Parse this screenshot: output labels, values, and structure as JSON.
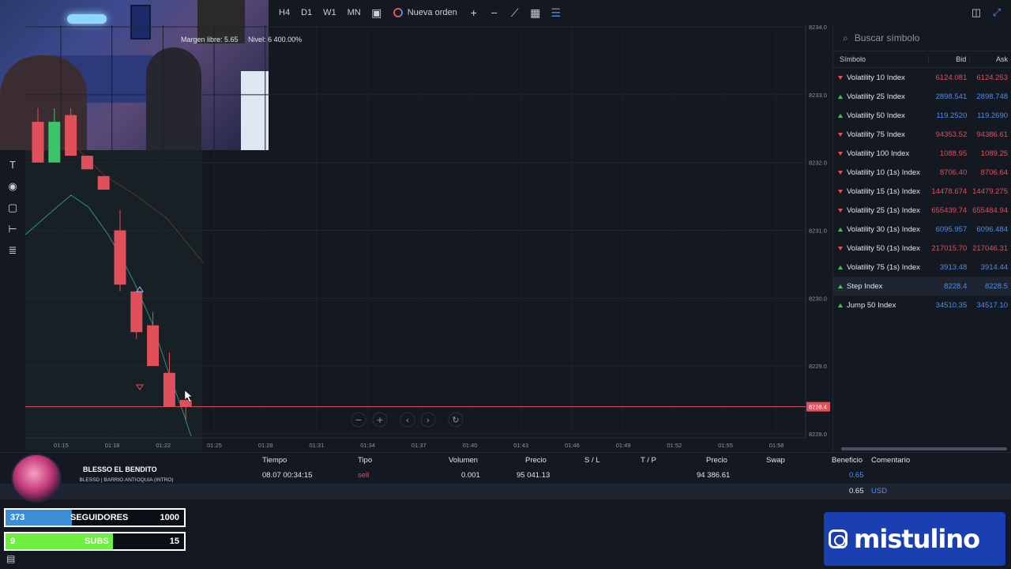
{
  "toolbar": {
    "timeframes": [
      "H4",
      "D1",
      "W1",
      "MN"
    ],
    "new_order": "Nueva orden"
  },
  "chart": {
    "price_ticks": [
      "8234.0",
      "8233.0",
      "8232.0",
      "8231.0",
      "8230.0",
      "8229.0",
      "8228.0"
    ],
    "current_price": "8228.4",
    "time_ticks": [
      "01:15",
      "01:18",
      "01:22",
      "01:25",
      "01:28",
      "01:31",
      "01:34",
      "01:37",
      "01:40",
      "01:43",
      "01:46",
      "01:49",
      "01:52",
      "01:55",
      "01:58"
    ],
    "candles": [
      {
        "o": 8232.6,
        "h": 8232.8,
        "l": 8232.0,
        "c": 8232.0
      },
      {
        "o": 8232.0,
        "h": 8232.8,
        "l": 8232.0,
        "c": 8232.6
      },
      {
        "o": 8232.7,
        "h": 8232.8,
        "l": 8232.1,
        "c": 8232.1
      },
      {
        "o": 8232.1,
        "h": 8232.1,
        "l": 8231.9,
        "c": 8231.9
      },
      {
        "o": 8231.8,
        "h": 8231.8,
        "l": 8231.6,
        "c": 8231.6
      },
      {
        "o": 8231.0,
        "h": 8231.3,
        "l": 8230.1,
        "c": 8230.2
      },
      {
        "o": 8230.1,
        "h": 8230.1,
        "l": 8229.4,
        "c": 8229.5
      },
      {
        "o": 8229.6,
        "h": 8229.8,
        "l": 8229.0,
        "c": 8229.0
      },
      {
        "o": 8228.9,
        "h": 8229.2,
        "l": 8228.4,
        "c": 8228.4
      },
      {
        "o": 8228.5,
        "h": 8228.5,
        "l": 8228.2,
        "c": 8228.4
      }
    ],
    "zoom_buttons": [
      "−",
      "+",
      "‹",
      "›",
      "↻"
    ]
  },
  "panel": {
    "search_placeholder": "Buscar símbolo",
    "headers": {
      "symbol": "Símbolo",
      "bid": "Bid",
      "ask": "Ask"
    },
    "rows": [
      {
        "dir": "down",
        "name": "Volatility 10 Index",
        "bid": "6124.081",
        "ask": "6124.253",
        "color": "red"
      },
      {
        "dir": "up",
        "name": "Volatility 25 Index",
        "bid": "2898.541",
        "ask": "2898.748",
        "color": "blue"
      },
      {
        "dir": "up",
        "name": "Volatility 50 Index",
        "bid": "119.2520",
        "ask": "119.2690",
        "color": "blue"
      },
      {
        "dir": "down",
        "name": "Volatility 75 Index",
        "bid": "94353.52",
        "ask": "94386.61",
        "color": "red"
      },
      {
        "dir": "down",
        "name": "Volatility 100 Index",
        "bid": "1088.95",
        "ask": "1089.25",
        "color": "red"
      },
      {
        "dir": "down",
        "name": "Volatility 10 (1s) Index",
        "bid": "8706.40",
        "ask": "8706.64",
        "color": "red"
      },
      {
        "dir": "down",
        "name": "Volatility 15 (1s) Index",
        "bid": "14478.674",
        "ask": "14479.275",
        "color": "red"
      },
      {
        "dir": "down",
        "name": "Volatility 25 (1s) Index",
        "bid": "655439.74",
        "ask": "655484.94",
        "color": "red"
      },
      {
        "dir": "up",
        "name": "Volatility 30 (1s) Index",
        "bid": "6095.957",
        "ask": "6096.484",
        "color": "blue"
      },
      {
        "dir": "down",
        "name": "Volatility 50 (1s) Index",
        "bid": "217015.70",
        "ask": "217046.31",
        "color": "red"
      },
      {
        "dir": "up",
        "name": "Volatility 75 (1s) Index",
        "bid": "3913.48",
        "ask": "3914.44",
        "color": "blue"
      },
      {
        "dir": "up",
        "name": "Step Index",
        "bid": "8228.4",
        "ask": "8228.5",
        "color": "blue"
      },
      {
        "dir": "up",
        "name": "Jump 50 Index",
        "bid": "34510.35",
        "ask": "34517.10",
        "color": "blue"
      }
    ]
  },
  "trades": {
    "headers": {
      "time": "Tiempo",
      "type": "Tipo",
      "volume": "Volumen",
      "price": "Precio",
      "sl": "S / L",
      "tp": "T / P",
      "price2": "Precio",
      "swap": "Swap",
      "profit": "Beneficio",
      "comment": "Comentario"
    },
    "row": {
      "time": "08.07 00:34:15",
      "type": "sell",
      "volume": "0.001",
      "price": "95 041.13",
      "price2": "94 386.61",
      "profit": "0.65"
    },
    "summary": {
      "margin": "Margen libre: 5.65",
      "level": "Nivel: 6 400.00%",
      "profit": "0.65",
      "currency": "USD"
    }
  },
  "overlay": {
    "streamer_name": "BLESSO EL BENDITO",
    "song": "BLESSD | BARRIO ANTIOQUIA (INTRO)",
    "followers": {
      "current": "373",
      "label": "SEGUIDORES",
      "goal": "1000",
      "progress": 0.373
    },
    "subs": {
      "current": "9",
      "label": "SUBS",
      "goal": "15",
      "progress": 0.6
    },
    "instagram": "mistulino"
  },
  "colors": {
    "bear": "#e0505a",
    "bull": "#3cc46a",
    "accent": "#4a8ff0",
    "bg": "#141821"
  }
}
